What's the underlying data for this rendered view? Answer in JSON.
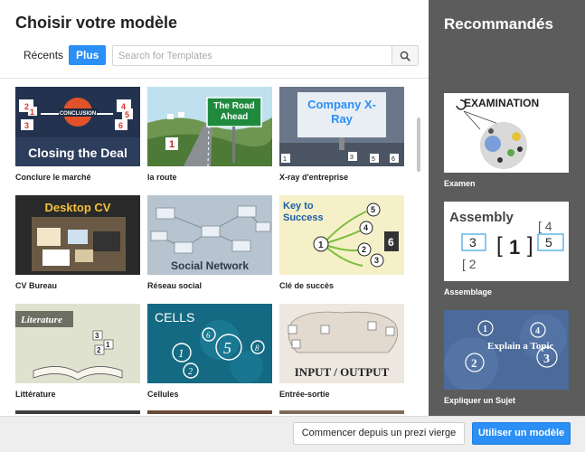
{
  "dialog": {
    "title": "Choisir votre modèle",
    "tabs": [
      {
        "label": "Récents",
        "active": false
      },
      {
        "label": "Plus",
        "active": true
      }
    ],
    "search": {
      "placeholder": "Search for Templates",
      "value": ""
    },
    "templates": [
      {
        "label": "Conclure le marché",
        "thumb_text": "Closing the Deal",
        "badge_text": "CONCLUSION"
      },
      {
        "label": "la route",
        "thumb_text": "The Road Ahead"
      },
      {
        "label": "X-ray d'entreprise",
        "thumb_text": "Company X-Ray"
      },
      {
        "label": "CV Bureau",
        "thumb_text": "Desktop CV"
      },
      {
        "label": "Réseau social",
        "thumb_text": "Social Network"
      },
      {
        "label": "Clé de succès",
        "thumb_text": "Key to Success"
      },
      {
        "label": "Littérature",
        "thumb_text": "Literature"
      },
      {
        "label": "Cellules",
        "thumb_text": "CELLS"
      },
      {
        "label": "Entrée-sortie",
        "thumb_text": "INPUT / OUTPUT"
      }
    ]
  },
  "recommended": {
    "title": "Recommandés",
    "items": [
      {
        "label": "Examen",
        "thumb_text": "EXAMINATION"
      },
      {
        "label": "Assemblage",
        "thumb_text": "Assembly"
      },
      {
        "label": "Expliquer un Sujet",
        "thumb_text": "Explain a Topic"
      }
    ]
  },
  "footer": {
    "blank_button": "Commencer depuis un prezi vierge",
    "use_button": "Utiliser un modèle"
  },
  "colors": {
    "accent": "#2b8ff5",
    "side_panel": "#5c5c5c",
    "footer": "#eeeeee"
  }
}
